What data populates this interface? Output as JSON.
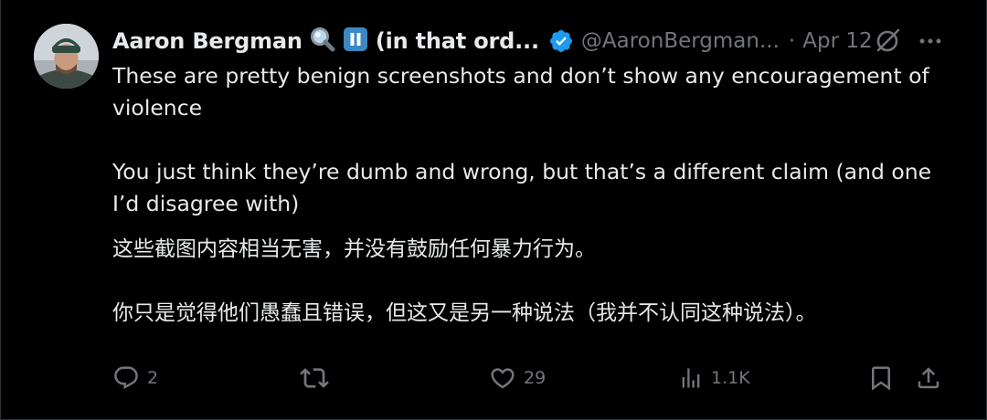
{
  "author": {
    "display_name": "Aaron Bergman",
    "name_suffix": "(in that ord...",
    "handle": "@AaronBergman...",
    "separator": "·",
    "date": "Apr 12",
    "verified": true,
    "name_emojis": [
      "magnifying-glass-emoji",
      "pause-button-emoji"
    ]
  },
  "tweet": {
    "line1": "These are pretty benign screenshots and don’t show any encouragement of",
    "line2": "violence",
    "line3": "You just think they’re dumb and wrong, but that’s a different claim (and one",
    "line4": "I’d disagree with)"
  },
  "translation": {
    "line1": "这些截图内容相当无害，并没有鼓励任何暴力行为。",
    "line2": "你只是觉得他们愚蠢且错误，但这又是另一种说法（我并不认同这种说法）。"
  },
  "actions": {
    "replies": "2",
    "reposts": "",
    "likes": "29",
    "views": "1.1K"
  },
  "colors": {
    "background": "#000000",
    "text": "#e7e9ea",
    "muted": "#71767b",
    "verified_blue": "#1d9bf0",
    "border": "#2f3336"
  },
  "icons": {
    "reply": "reply-icon",
    "repost": "repost-icon",
    "like": "like-icon",
    "views": "views-icon",
    "bookmark": "bookmark-icon",
    "share": "share-icon",
    "grok": "grok-icon",
    "more": "more-icon"
  }
}
